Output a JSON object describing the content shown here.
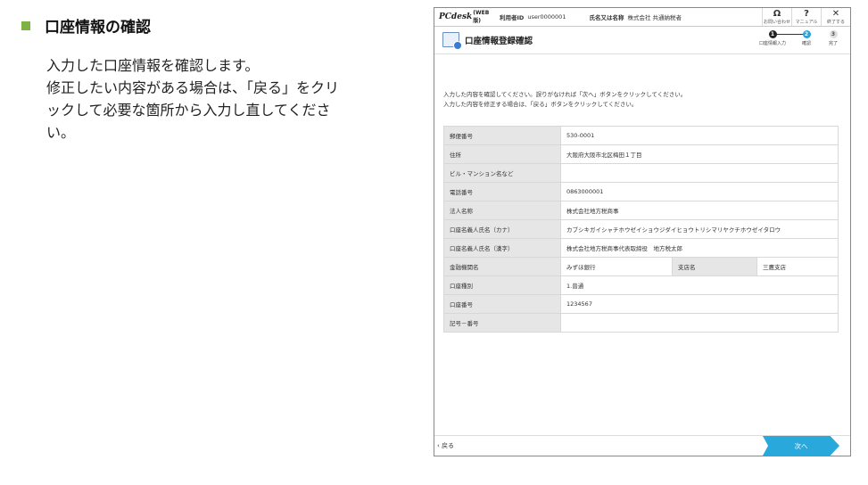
{
  "section": {
    "title": "口座情報の確認",
    "lines": [
      "入力した口座情報を確認します。",
      "修正したい内容がある場合は、「戻る」をクリ",
      "ックして必要な箇所から入力し直してくださ",
      "い。"
    ]
  },
  "app": {
    "logo": "PCdesk",
    "logo_sub": "(WEB版)",
    "user_label": "利用者ID",
    "user_value": "user0000001",
    "name_label": "氏名又は名称",
    "name_value": "株式会社 共通納税者",
    "buttons": [
      {
        "icon": "headset-icon",
        "glyph": "Ω",
        "label": "お問い合わせ"
      },
      {
        "icon": "question-icon",
        "glyph": "?",
        "label": "マニュアル"
      },
      {
        "icon": "close-icon",
        "glyph": "✕",
        "label": "終了する"
      }
    ]
  },
  "page": {
    "title": "口座情報登録確認",
    "steps": [
      {
        "num": "1",
        "label": "口座情報入力",
        "state": "done"
      },
      {
        "num": "2",
        "label": "確認",
        "state": "current"
      },
      {
        "num": "3",
        "label": "完了",
        "state": "todo"
      }
    ],
    "intro": [
      "入力した内容を確認してください。誤りがなければ「次へ」ボタンをクリックしてください。",
      "入力した内容を修正する場合は、「戻る」ボタンをクリックしてください。"
    ]
  },
  "fields": {
    "postal": {
      "label": "郵便番号",
      "value": "530-0001"
    },
    "address": {
      "label": "住所",
      "value": "大阪府大阪市北区梅田１丁目"
    },
    "building": {
      "label": "ビル・マンション名など",
      "value": ""
    },
    "phone": {
      "label": "電話番号",
      "value": "0863000001"
    },
    "corp": {
      "label": "法人名称",
      "value": "株式会社地方税商事"
    },
    "holder_kana": {
      "label": "口座名義人氏名（カナ）",
      "value": "カブシキガイシャチホウゼイショウジダイヒョウトリシマリヤクチホウゼイタロウ"
    },
    "holder_kanji": {
      "label": "口座名義人氏名（漢字）",
      "value": "株式会社地方税商事代表取締役　地方税太郎"
    },
    "bank": {
      "label": "金融機関名",
      "value": "みずほ銀行",
      "branch_label": "支店名",
      "branch_value": "三鷹支店"
    },
    "type": {
      "label": "口座種別",
      "value": "1.普通"
    },
    "number": {
      "label": "口座番号",
      "value": "1234567"
    },
    "symbol": {
      "label": "記号－番号",
      "value": ""
    }
  },
  "footer": {
    "back": "戻る",
    "next": "次へ"
  },
  "colors": {
    "accent": "#29a8dc",
    "bullet": "#7cb342",
    "label_bg": "#e6e6e6"
  }
}
